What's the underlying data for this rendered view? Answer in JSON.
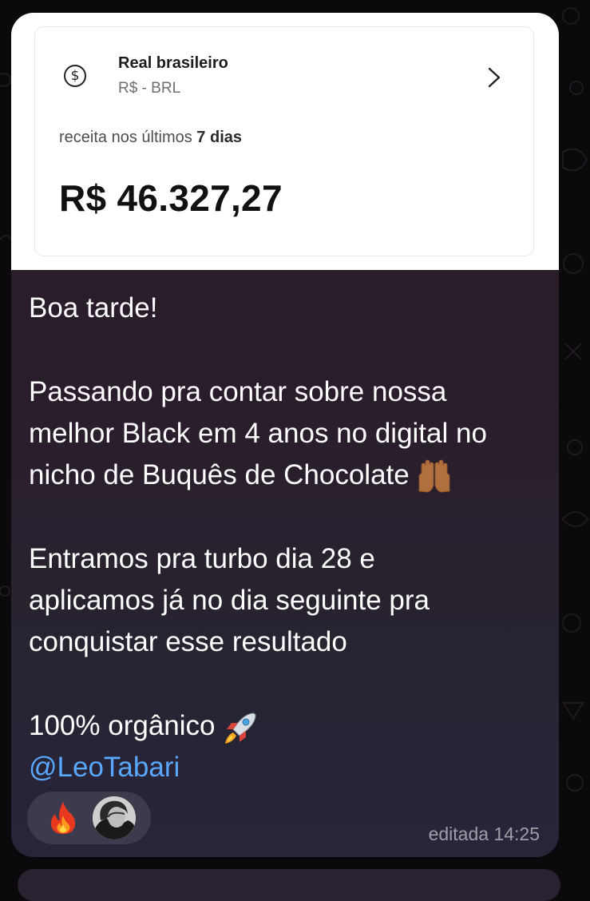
{
  "card": {
    "currency_symbol": "$",
    "currency_name": "Real brasileiro",
    "currency_code": "R$ - BRL",
    "revenue_label_prefix": "receita nos últimos ",
    "revenue_label_days": "7 dias",
    "revenue_value": "R$ 46.327,27"
  },
  "message": {
    "lines": [
      "Boa tarde!",
      "",
      "Passando pra contar sobre nossa",
      "melhor Black em 4 anos no digital no",
      "nicho de Buquês de Chocolate",
      "",
      "Entramos pra turbo dia 28 e",
      "aplicamos já no dia seguinte pra",
      "conquistar esse resultado",
      "",
      "100% orgânico"
    ],
    "mention": "@LeoTabari",
    "emojis": [
      "raising-hands",
      "rocket"
    ]
  },
  "reactions": {
    "emoji": "fire",
    "count_avatars": 1
  },
  "meta": {
    "timestamp": "editada 14:25"
  },
  "colors": {
    "bubble": "#2b1c29",
    "mention": "#5aa7ff",
    "text": "#ffffff",
    "card_bg": "#ffffff"
  }
}
